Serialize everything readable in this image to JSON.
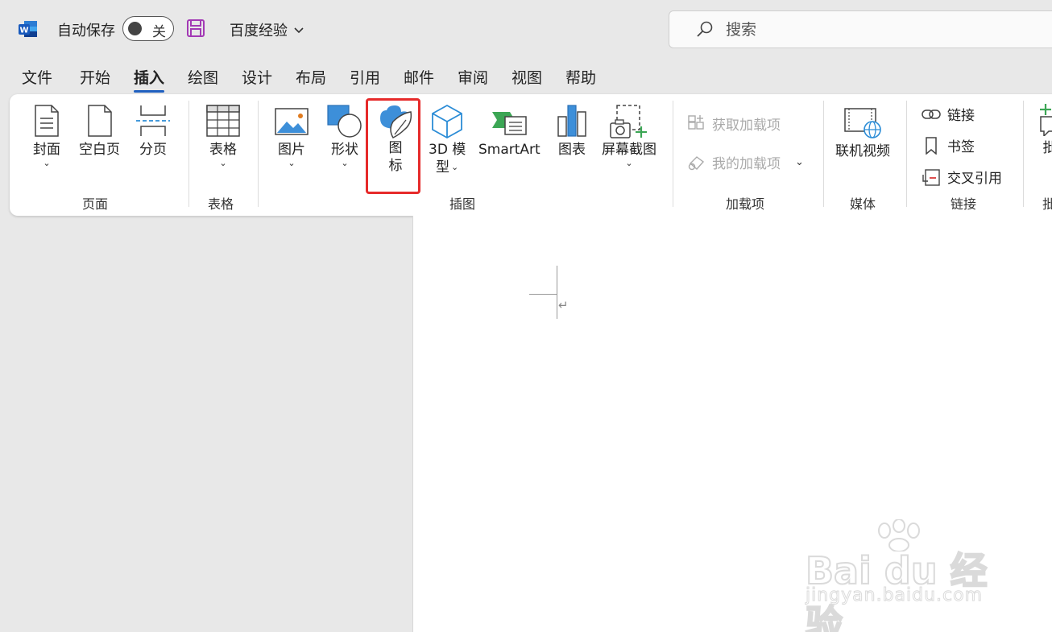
{
  "titlebar": {
    "autosave_label": "自动保存",
    "autosave_state": "关",
    "doc_title": "百度经验",
    "search_placeholder": "搜索"
  },
  "tabs": [
    {
      "label": "文件"
    },
    {
      "label": "开始"
    },
    {
      "label": "插入",
      "active": true
    },
    {
      "label": "绘图"
    },
    {
      "label": "设计"
    },
    {
      "label": "布局"
    },
    {
      "label": "引用"
    },
    {
      "label": "邮件"
    },
    {
      "label": "审阅"
    },
    {
      "label": "视图"
    },
    {
      "label": "帮助"
    }
  ],
  "ribbon": {
    "pages": {
      "cover": "封面",
      "blank": "空白页",
      "break": "分页",
      "group": "页面"
    },
    "table": {
      "table": "表格",
      "group": "表格"
    },
    "illustrations": {
      "pictures": "图片",
      "shapes": "形状",
      "icons_line1": "图",
      "icons_line2": "标",
      "model_line1": "3D 模",
      "model_line2": "型",
      "smartart": "SmartArt",
      "chart": "图表",
      "screenshot": "屏幕截图",
      "group": "插图"
    },
    "addins": {
      "get": "获取加载项",
      "my": "我的加载项",
      "group": "加载项"
    },
    "media": {
      "video": "联机视频",
      "group": "媒体"
    },
    "links": {
      "link": "链接",
      "bookmark": "书签",
      "crossref": "交叉引用",
      "group": "链接"
    },
    "partial": {
      "label": "批"
    }
  },
  "document": {
    "paragraph_mark": "↵"
  },
  "watermark": {
    "brand": "Bai du 经验",
    "site": "jingyan.baidu.com"
  },
  "colors": {
    "accent": "#1f5fbf",
    "highlight": "#e62a2a",
    "word_blue": "#185abd"
  }
}
